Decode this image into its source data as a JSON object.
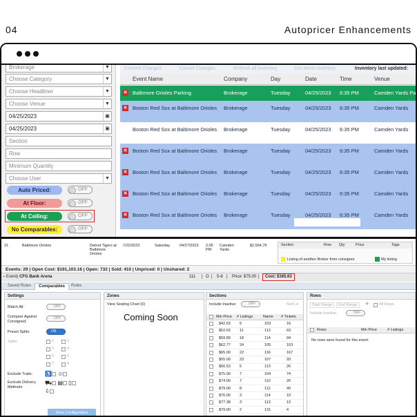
{
  "slide": {
    "number": "04",
    "title": "Autopricer Enhancements"
  },
  "shot1": {
    "filters": {
      "brokerage": "Brokerage",
      "category": "Choose Category",
      "headliner": "Choose Headliner",
      "venue": "Choose Venue",
      "date_from": "04/25/2023",
      "date_to": "04/25/2023",
      "section": "Section",
      "row": "Row",
      "min_qty": "Minimum Quantity",
      "user": "Choose User",
      "auto_priced": "Auto Priced:",
      "at_floor": "At Floor:",
      "at_ceiling": "At Ceiling:",
      "no_comparables": "No Comparables:",
      "toggle_off": "OFF"
    },
    "toolbar": {
      "commit": "Commit Changes",
      "cancel": "Cancel Changes",
      "refresh": "Refresh all inventory",
      "latest": "Get latest inventory",
      "inventory_updated": "Inventory last updated:"
    },
    "columns": [
      "Event Name",
      "Company",
      "Day",
      "Date",
      "Time",
      "Venue"
    ],
    "rows": [
      {
        "event": "Baltimore Orioles Parking",
        "company": "Brokerage",
        "day": "Tuesday",
        "date": "04/25/2023",
        "time": "6:35 PM",
        "venue": "Camden Yards Parki"
      },
      {
        "event": "Boston Red Sox at Baltimore Orioles",
        "company": "Brokerage",
        "day": "Tuesday",
        "date": "04/25/2023",
        "time": "6:35 PM",
        "venue": "Camden Yards"
      },
      {
        "event": "Boston Red Sox at Baltimore Orioles",
        "company": "Brokerage",
        "day": "Tuesday",
        "date": "04/25/2023",
        "time": "6:35 PM",
        "venue": "Camden Yards"
      },
      {
        "event": "Boston Red Sox at Baltimore Orioles",
        "company": "Brokerage",
        "day": "Tuesday",
        "date": "04/25/2023",
        "time": "6:35 PM",
        "venue": "Camden Yards"
      },
      {
        "event": "Boston Red Sox at Baltimore Orioles",
        "company": "Brokerage",
        "day": "Tuesday",
        "date": "04/25/2023",
        "time": "6:35 PM",
        "venue": "Camden Yards"
      },
      {
        "event": "Boston Red Sox at Baltimore Orioles",
        "company": "Brokerage",
        "day": "Tuesday",
        "date": "04/25/2023",
        "time": "6:35 PM",
        "venue": "Camden Yards"
      },
      {
        "event": "Boston Red Sox at Baltimore Orioles",
        "company": "Brokerage",
        "day": "Tuesday",
        "date": "04/25/2023",
        "time": "6:35 PM",
        "venue": "Camden Yards"
      }
    ],
    "colors": {
      "parking_row": "#16a05c",
      "selected_row": "#a9c4ee",
      "white_row": "#ffffff",
      "auto_priced": "#9db9f0",
      "at_floor": "#f19a9a",
      "at_ceiling": "#1aa055",
      "no_comparables": "#ffee32",
      "highlight_red": "#d9262c"
    }
  },
  "shot2": {
    "top_row": {
      "a": "21",
      "b": "Baltimore Orioles",
      "c": "Detroit Tigers at Baltimore Orioles",
      "d": "7/22/2023",
      "e": "Saturday",
      "f": "04/27/2023",
      "g": "2:05 PM",
      "h": "Camden Yards",
      "i": "$2,564.78"
    },
    "right_grid_cols": [
      "Section",
      "Row",
      "Qty",
      "Price",
      "Tags"
    ],
    "legend": {
      "another_broker": "Listing of another Broker from consignor",
      "my_listing": "My listing"
    },
    "stats": {
      "events": "Events: 29",
      "open_cost": "Open Cost: $191,103.16",
      "open": "Open: 732",
      "sold": "Sold: 410",
      "unpriced": "Unpriced: 0",
      "unshared": "Unshared: 2"
    },
    "eventbar": {
      "event": "– Event)",
      "venue": "CFG Bank Arena",
      "n1": "111",
      "n2": "O",
      "n3": "5-8",
      "price": "Price: $75.00",
      "cost": "Cost: $165.63"
    },
    "tabs": [
      "Saved Rules",
      "Comparables",
      "Rules"
    ],
    "settings": {
      "title": "Settings",
      "match_all": "Match All:",
      "compare_against": "Compare Against Consigned:",
      "preset_splits": "Preset Splits:",
      "splits": "Splits:",
      "exclude_traits": "Exclude Traits:",
      "exclude_delivery": "Exclude Delivery Methods:",
      "off": "OFF",
      "on": "ON",
      "split_numbers": [
        "1",
        "2",
        "3",
        "4",
        "5",
        "6",
        "7",
        "8"
      ],
      "button": "Save Configuration"
    },
    "zones": {
      "title": "Zones",
      "view_chart": "View Seating Chart (0)",
      "coming_soon": "Coming Soon"
    },
    "sections": {
      "title": "Sections",
      "include_inactive": "Include Inactive:",
      "next": "Next ➔",
      "columns": [
        "Min Price",
        "# Listings",
        "Name",
        "# Tickets"
      ],
      "rows": [
        {
          "price": "$42.63",
          "listings": "5",
          "name": "103",
          "tickets": "16"
        },
        {
          "price": "$52.63",
          "listings": "11",
          "name": "113",
          "tickets": "63"
        },
        {
          "price": "$59.89",
          "listings": "18",
          "name": "114",
          "tickets": "94"
        },
        {
          "price": "$62.77",
          "listings": "24",
          "name": "105",
          "tickets": "103"
        },
        {
          "price": "$65.00",
          "listings": "22",
          "name": "116",
          "tickets": "167"
        },
        {
          "price": "$55.00",
          "listings": "23",
          "name": "107",
          "tickets": "93"
        },
        {
          "price": "$56.53",
          "listings": "5",
          "name": "113",
          "tickets": "26"
        },
        {
          "price": "$75.00",
          "listings": "7",
          "name": "104",
          "tickets": "74"
        },
        {
          "price": "$74.00",
          "listings": "7",
          "name": "110",
          "tickets": "26"
        },
        {
          "price": "$79.00",
          "listings": "8",
          "name": "112",
          "tickets": "40"
        },
        {
          "price": "$76.00",
          "listings": "3",
          "name": "114",
          "tickets": "10"
        },
        {
          "price": "$77.38",
          "listings": "3",
          "name": "113",
          "tickets": "13"
        },
        {
          "price": "$79.00",
          "listings": "2",
          "name": "115",
          "tickets": "4"
        }
      ]
    },
    "rows_panel": {
      "title": "Rows",
      "start_range": "Start Range",
      "end_range": "End Range",
      "plus": "+",
      "all_rows": "All Rows",
      "include_inactive": "Include Inactive:",
      "columns": [
        "Rows",
        "Min Price",
        "# Listings"
      ],
      "empty": "No rows were found for this event."
    }
  }
}
